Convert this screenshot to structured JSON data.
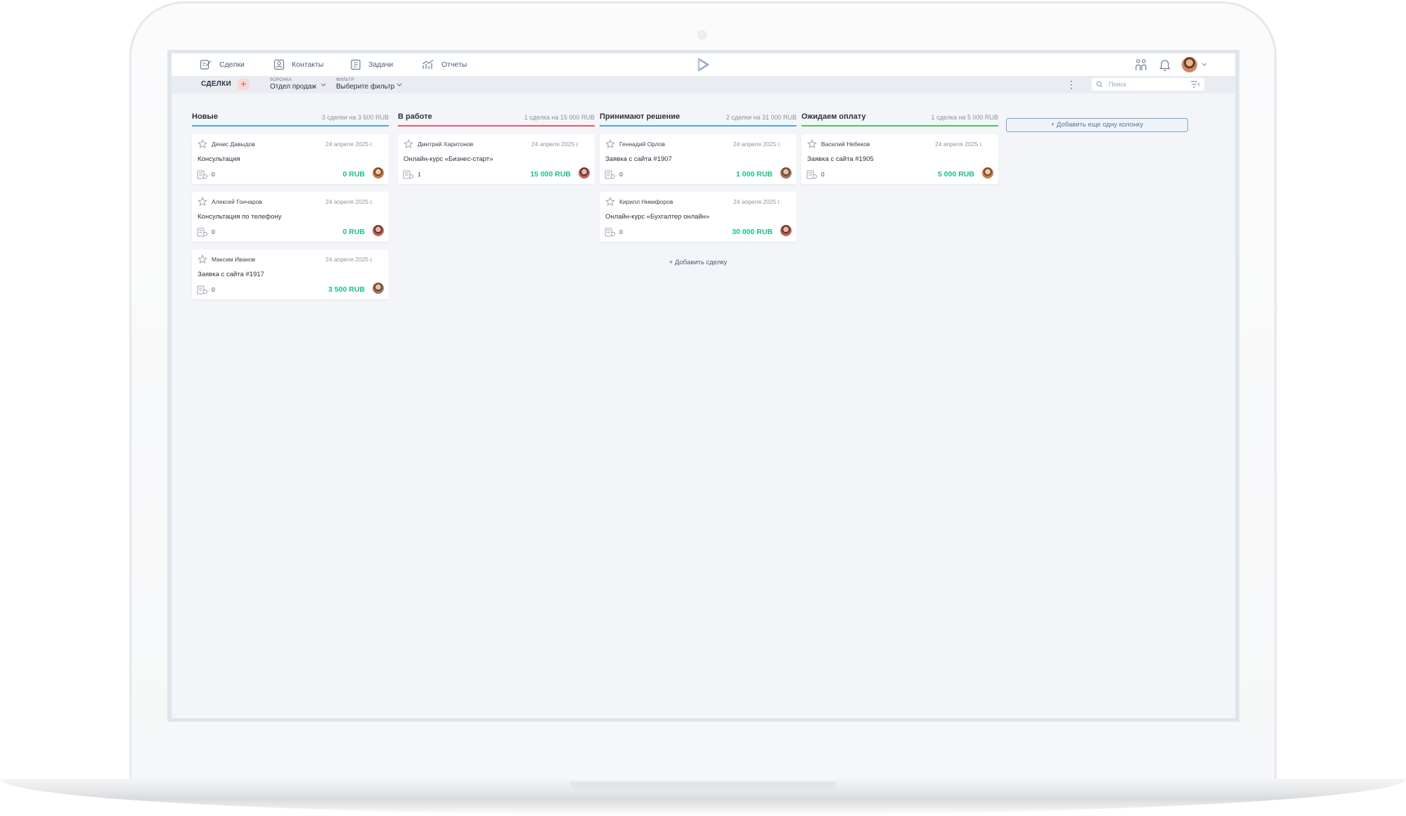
{
  "nav": {
    "items": [
      {
        "label": "Сделки",
        "icon": "deals-icon"
      },
      {
        "label": "Контакты",
        "icon": "contacts-icon"
      },
      {
        "label": "Задачи",
        "icon": "tasks-icon"
      },
      {
        "label": "Отчеты",
        "icon": "reports-icon"
      }
    ]
  },
  "subbar": {
    "title": "СДЕЛКИ",
    "add_symbol": "+",
    "funnel_label": "ВОРОНКА",
    "funnel_value": "Отдел продаж",
    "filter_label": "ФИЛЬТР",
    "filter_value": "Выберите фильтр",
    "search_placeholder": "Поиск"
  },
  "colors": {
    "accent_green": "#1bbf86",
    "col_new": "#4aa8e0",
    "col_work": "#e2577a",
    "col_decision": "#4aa8e0",
    "col_payment": "#4cbf6a"
  },
  "columns": [
    {
      "title": "Новые",
      "summary": "3 сделки на 3 500 RUB",
      "color": "#4aa8e0",
      "cards": [
        {
          "person": "Денис Давыдов",
          "date": "24 апреля 2025 г.",
          "name": "Консультация",
          "count": "0",
          "amount": "0 RUB"
        },
        {
          "person": "Алексей Гончаров",
          "date": "24 апреля 2025 г.",
          "name": "Консультация по телефону",
          "count": "0",
          "amount": "0 RUB"
        },
        {
          "person": "Максим Иванов",
          "date": "24 апреля 2025 г.",
          "name": "Заявка с сайта #1917",
          "count": "0",
          "amount": "3 500 RUB"
        }
      ]
    },
    {
      "title": "В работе",
      "summary": "1 сделка на 15 000 RUB",
      "color": "#e2577a",
      "cards": [
        {
          "person": "Дмитрий Харитонов",
          "date": "24 апреля 2025 г.",
          "name": "Онлайн-курс «Бизнес-старт»",
          "count": "1",
          "amount": "15 000 RUB"
        }
      ]
    },
    {
      "title": "Принимают решение",
      "summary": "2 сделки на 31 000 RUB",
      "color": "#4aa8e0",
      "cards": [
        {
          "person": "Геннадий Орлов",
          "date": "24 апреля 2025 г.",
          "name": "Заявка с сайта #1907",
          "count": "0",
          "amount": "1 000 RUB"
        },
        {
          "person": "Кирилл Никифоров",
          "date": "24 апреля 2025 г.",
          "name": "Онлайн-курс «Бухгалтер онлайн»",
          "count": "0",
          "amount": "30 000 RUB"
        }
      ],
      "add_deal": "+ Добавить сделку"
    },
    {
      "title": "Ожидаем оплату",
      "summary": "1 сделка на 5 000 RUB",
      "color": "#4cbf6a",
      "cards": [
        {
          "person": "Василий Небеков",
          "date": "24 апреля 2025 г.",
          "name": "Заявка с сайта #1905",
          "count": "0",
          "amount": "5 000 RUB"
        }
      ]
    }
  ],
  "add_column": "+ Добавить еще одну колонку"
}
